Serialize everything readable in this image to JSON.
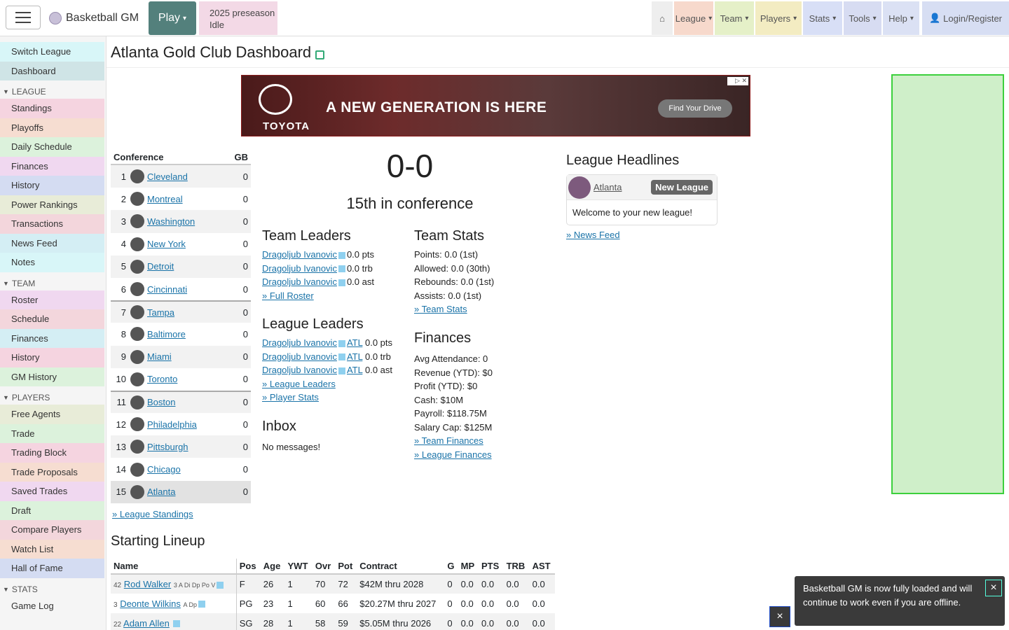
{
  "topbar": {
    "brand": "Basketball GM",
    "play": "Play",
    "status_line1": "2025 preseason",
    "status_line2": "Idle",
    "nav": [
      "League",
      "Team",
      "Players",
      "Stats",
      "Tools",
      "Help"
    ],
    "login": "Login/Register"
  },
  "sidebar": {
    "top": [
      "Switch League",
      "Dashboard"
    ],
    "league_head": "LEAGUE",
    "league": [
      "Standings",
      "Playoffs",
      "Daily Schedule",
      "Finances",
      "History",
      "Power Rankings",
      "Transactions",
      "News Feed",
      "Notes"
    ],
    "team_head": "TEAM",
    "team": [
      "Roster",
      "Schedule",
      "Finances",
      "History",
      "GM History"
    ],
    "players_head": "PLAYERS",
    "players": [
      "Free Agents",
      "Trade",
      "Trading Block",
      "Trade Proposals",
      "Saved Trades",
      "Draft",
      "Compare Players",
      "Watch List",
      "Hall of Fame"
    ],
    "stats_head": "STATS",
    "stats": [
      "Game Log"
    ]
  },
  "page": {
    "title": "Atlanta Gold Club Dashboard"
  },
  "ad": {
    "headline": "A NEW GENERATION IS HERE",
    "brand": "TOYOTA",
    "cta": "Find Your Drive"
  },
  "conference": {
    "header": "Conference",
    "gb_header": "GB",
    "teams": [
      {
        "rank": "1",
        "name": "Cleveland",
        "gb": "0"
      },
      {
        "rank": "2",
        "name": "Montreal",
        "gb": "0"
      },
      {
        "rank": "3",
        "name": "Washington",
        "gb": "0"
      },
      {
        "rank": "4",
        "name": "New York",
        "gb": "0"
      },
      {
        "rank": "5",
        "name": "Detroit",
        "gb": "0"
      },
      {
        "rank": "6",
        "name": "Cincinnati",
        "gb": "0"
      },
      {
        "rank": "7",
        "name": "Tampa",
        "gb": "0"
      },
      {
        "rank": "8",
        "name": "Baltimore",
        "gb": "0"
      },
      {
        "rank": "9",
        "name": "Miami",
        "gb": "0"
      },
      {
        "rank": "10",
        "name": "Toronto",
        "gb": "0"
      },
      {
        "rank": "11",
        "name": "Boston",
        "gb": "0"
      },
      {
        "rank": "12",
        "name": "Philadelphia",
        "gb": "0"
      },
      {
        "rank": "13",
        "name": "Pittsburgh",
        "gb": "0"
      },
      {
        "rank": "14",
        "name": "Chicago",
        "gb": "0"
      },
      {
        "rank": "15",
        "name": "Atlanta",
        "gb": "0"
      }
    ],
    "footer": "» League Standings"
  },
  "record": {
    "value": "0-0",
    "conf_rank": "15th in conference"
  },
  "team_leaders": {
    "title": "Team Leaders",
    "rows": [
      {
        "name": "Dragoljub Ivanovic",
        "value": "0.0 pts"
      },
      {
        "name": "Dragoljub Ivanovic",
        "value": "0.0 trb"
      },
      {
        "name": "Dragoljub Ivanovic",
        "value": "0.0 ast"
      }
    ],
    "link": "» Full Roster"
  },
  "league_leaders": {
    "title": "League Leaders",
    "rows": [
      {
        "name": "Dragoljub Ivanovic",
        "team": "ATL",
        "value": "0.0 pts"
      },
      {
        "name": "Dragoljub Ivanovic",
        "team": "ATL",
        "value": "0.0 trb"
      },
      {
        "name": "Dragoljub Ivanovic",
        "team": "ATL",
        "value": "0.0 ast"
      }
    ],
    "link1": "» League Leaders",
    "link2": "» Player Stats"
  },
  "inbox": {
    "title": "Inbox",
    "message": "No messages!"
  },
  "team_stats": {
    "title": "Team Stats",
    "lines": [
      "Points: 0.0 (1st)",
      "Allowed: 0.0 (30th)",
      "Rebounds: 0.0 (1st)",
      "Assists: 0.0 (1st)"
    ],
    "link": "» Team Stats"
  },
  "finances": {
    "title": "Finances",
    "lines": [
      "Avg Attendance: 0",
      "Revenue (YTD): $0",
      "Profit (YTD): $0",
      "Cash: $10M",
      "Payroll: $118.75M",
      "Salary Cap: $125M"
    ],
    "link1": "» Team Finances",
    "link2": "» League Finances"
  },
  "headlines": {
    "title": "League Headlines",
    "team": "Atlanta",
    "badge": "New League",
    "message": "Welcome to your new league!",
    "link": "» News Feed"
  },
  "lineup": {
    "title": "Starting Lineup",
    "headers": [
      "Name",
      "Pos",
      "Age",
      "YWT",
      "Ovr",
      "Pot",
      "Contract",
      "G",
      "MP",
      "PTS",
      "TRB",
      "AST"
    ],
    "rows": [
      {
        "num": "42",
        "name": "Rod Walker",
        "skills": "3 A Di Dp Po V",
        "pos": "F",
        "age": "26",
        "ywt": "1",
        "ovr": "70",
        "pot": "72",
        "contract": "$42M thru 2028",
        "g": "0",
        "mp": "0.0",
        "pts": "0.0",
        "trb": "0.0",
        "ast": "0.0"
      },
      {
        "num": "3",
        "name": "Deonte Wilkins",
        "skills": "A Dp",
        "pos": "PG",
        "age": "23",
        "ywt": "1",
        "ovr": "60",
        "pot": "66",
        "contract": "$20.27M thru 2027",
        "g": "0",
        "mp": "0.0",
        "pts": "0.0",
        "trb": "0.0",
        "ast": "0.0"
      },
      {
        "num": "22",
        "name": "Adam Allen",
        "skills": "",
        "pos": "SG",
        "age": "28",
        "ywt": "1",
        "ovr": "58",
        "pot": "59",
        "contract": "$5.05M thru 2026",
        "g": "0",
        "mp": "0.0",
        "pts": "0.0",
        "trb": "0.0",
        "ast": "0.0"
      }
    ]
  },
  "toast": {
    "message": "Basketball GM is now fully loaded and will continue to work even if you are offline."
  },
  "icons": {
    "close": "×"
  }
}
